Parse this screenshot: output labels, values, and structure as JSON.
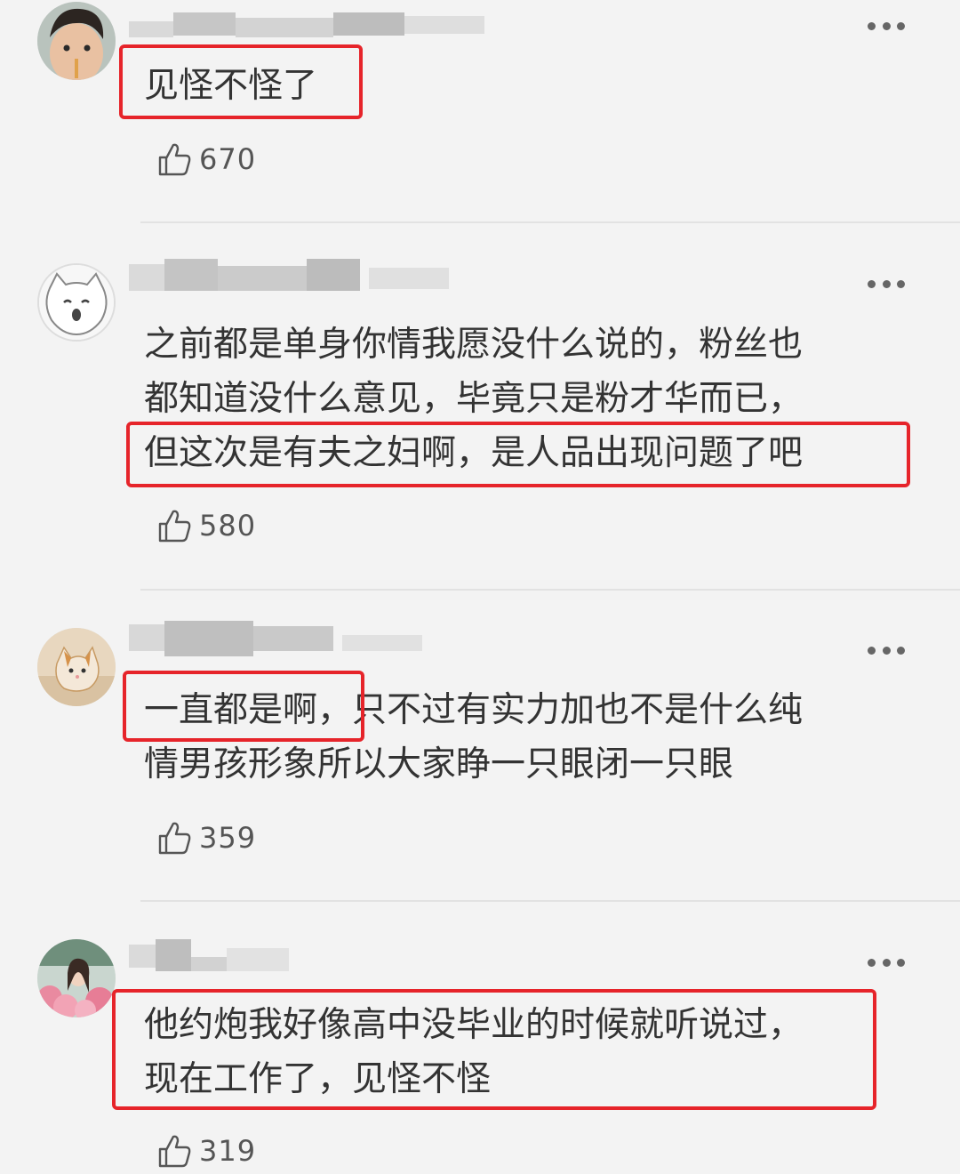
{
  "comments": [
    {
      "avatar": "toddler-photo",
      "lines": [
        "见怪不怪了"
      ],
      "likes": "670"
    },
    {
      "avatar": "cartoon-cat-face",
      "lines": [
        "之前都是单身你情我愿没什么说的，粉丝也",
        "都知道没什么意见，毕竟只是粉才华而已，",
        "但这次是有夫之妇啊，是人品出现问题了吧"
      ],
      "likes": "580"
    },
    {
      "avatar": "cat-photo",
      "lines": [
        "一直都是啊，只不过有实力加也不是什么纯",
        "情男孩形象所以大家睁一只眼闭一只眼"
      ],
      "likes": "359"
    },
    {
      "avatar": "girl-with-flowers-photo",
      "lines": [
        "他约炮我好像高中没毕业的时候就听说过，",
        "现在工作了，见怪不怪"
      ],
      "likes": "319"
    }
  ],
  "icons": {
    "like": "thumbs-up-icon",
    "more": "more-dots-icon"
  },
  "colors": {
    "highlight": "#e6242a",
    "background": "#f3f3f3",
    "text": "#333333"
  }
}
